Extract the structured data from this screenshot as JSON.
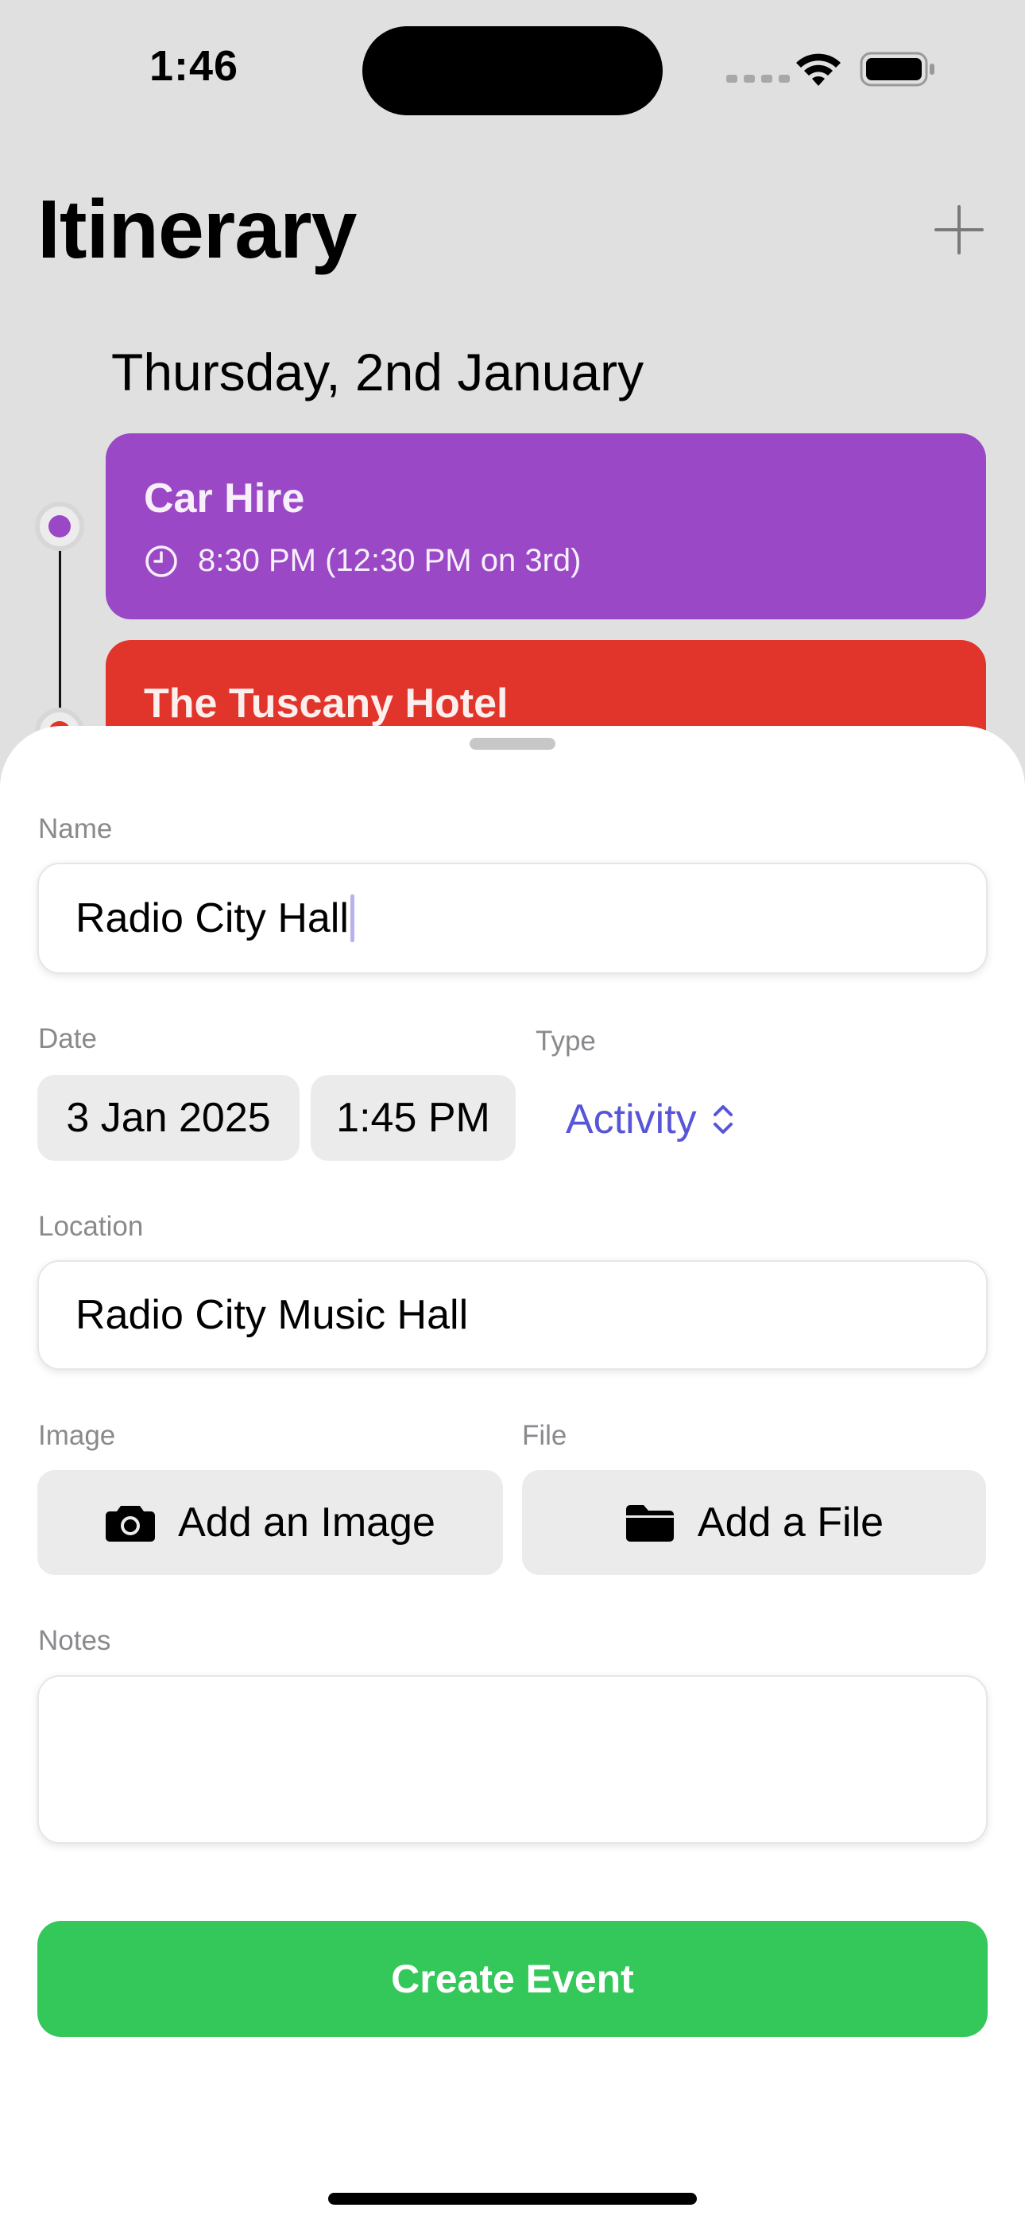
{
  "status_bar": {
    "time": "1:46"
  },
  "header": {
    "title": "Itinerary"
  },
  "day_heading": "Thursday, 2nd January",
  "events": [
    {
      "title": "Car Hire",
      "time": "8:30 PM (12:30 PM on 3rd)",
      "color": "#9b48c6"
    },
    {
      "title": "The Tuscany Hotel",
      "color": "#e1352b"
    }
  ],
  "form": {
    "name": {
      "label": "Name",
      "value": "Radio City Hall"
    },
    "date": {
      "label": "Date",
      "date_value": "3 Jan 2025",
      "time_value": "1:45 PM"
    },
    "type": {
      "label": "Type",
      "value": "Activity"
    },
    "location": {
      "label": "Location",
      "value": "Radio City Music Hall"
    },
    "image": {
      "label": "Image",
      "button": "Add an Image"
    },
    "file": {
      "label": "File",
      "button": "Add a File"
    },
    "notes": {
      "label": "Notes",
      "value": ""
    },
    "submit_label": "Create Event"
  },
  "colors": {
    "accent": "#5856d6",
    "submit": "#34c759",
    "car_hire": "#9b48c6",
    "hotel": "#e1352b"
  }
}
